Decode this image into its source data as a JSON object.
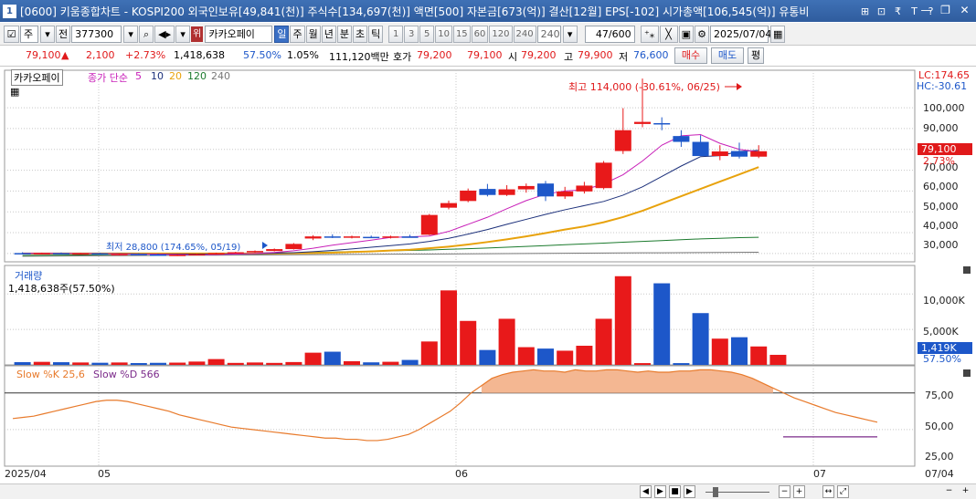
{
  "title_bar": {
    "window_number": "1",
    "text": "[0600] 키움종합차트 - KOSPI200 외국인보유[49,841(천)] 주식수[134,697(천)] 액면[500] 자본금[673(억)] 결산[12월] EPS[-102] 시가총액[106,545(억)] 유통비",
    "icons": [
      "⊞",
      "⊡",
      "₹",
      "T",
      "?"
    ],
    "window_buttons": [
      "—",
      "❐",
      "✕"
    ]
  },
  "toolbar": {
    "stock_code": "377300",
    "type_select": "주",
    "prev_label": "전",
    "stock_name": "카카오페이",
    "name_badge": "위",
    "periods": [
      "일",
      "주",
      "월",
      "년",
      "분",
      "초",
      "틱"
    ],
    "active_period": "일",
    "intervals": [
      "1",
      "3",
      "5",
      "10",
      "15",
      "60",
      "120",
      "240"
    ],
    "interval_select": "240",
    "count": "47",
    "count_total": "/600",
    "date": "2025/07/04"
  },
  "info_row": {
    "price": "79,100",
    "change": "2,100",
    "change_pct": "+2.73%",
    "volume": "1,418,638",
    "vol_ratio": "57.50%",
    "turnover": "1.05%",
    "amount": "111,120백만",
    "bid_label": "호가",
    "bid": "79,200",
    "ask": "79,100",
    "open_label": "시",
    "open": "79,200",
    "high_label": "고",
    "high": "79,900",
    "low_label": "저",
    "low": "76,600",
    "buy_label": "매수",
    "sell_label": "매도",
    "eval_label": "평"
  },
  "price_panel": {
    "stock_tag": "카카오페이",
    "ma_label": "종가 단순",
    "ma_periods": [
      "5",
      "10",
      "20",
      "120",
      "240"
    ],
    "ma_colors": [
      "#c81fb8",
      "#1b2f7a",
      "#e8a20c",
      "#1b7a2d",
      "#777777"
    ],
    "lc_label": "LC:174.65",
    "hc_label": "HC:-30.61",
    "high_annotation": "최고 114,000 (-30.61%, 06/25)",
    "low_annotation": "최저 28,800 (174.65%, 05/19)",
    "current_price_tag": "79,100",
    "current_pct_tag": "2.73%",
    "y_ticks": [
      "100,000",
      "90,000",
      "80,000",
      "70,000",
      "60,000",
      "50,000",
      "40,000",
      "30,000"
    ]
  },
  "volume_panel": {
    "title": "거래량",
    "value": "1,418,638주(57.50%)",
    "y_ticks": [
      "10,000K",
      "5,000K"
    ],
    "current_tag": "1,419K",
    "current_pct": "57.50%"
  },
  "stoch_panel": {
    "k_label": "Slow %K 25,6",
    "d_label": "Slow %D 566",
    "y_ticks": [
      "75,00",
      "50,00",
      "25,00"
    ]
  },
  "x_axis": {
    "labels": [
      "2025/04",
      "05",
      "06",
      "07"
    ],
    "right_label": "07/04"
  },
  "bottom_bar": {
    "buttons": [
      "◀",
      "▶",
      "■",
      "▶",
      "−",
      "+",
      "↔",
      "⤢",
      "−",
      "+"
    ]
  },
  "chart_data": {
    "type": "candlestick",
    "candles": [
      [
        30200,
        30600,
        29800,
        30000
      ],
      [
        30000,
        30400,
        29700,
        30200
      ],
      [
        30200,
        30500,
        29800,
        29900
      ],
      [
        29900,
        30300,
        29600,
        30100
      ],
      [
        30100,
        30300,
        29400,
        29600
      ],
      [
        29600,
        30000,
        29200,
        29800
      ],
      [
        29800,
        30100,
        29300,
        29500
      ],
      [
        29500,
        29900,
        29000,
        29200
      ],
      [
        29200,
        29600,
        28800,
        29400
      ],
      [
        29400,
        29900,
        29100,
        29700
      ],
      [
        29700,
        30400,
        29500,
        30200
      ],
      [
        30200,
        30800,
        30000,
        30600
      ],
      [
        30600,
        31500,
        30400,
        31200
      ],
      [
        31200,
        32400,
        31000,
        32100
      ],
      [
        32100,
        35000,
        31900,
        34600
      ],
      [
        37200,
        38800,
        36400,
        38200
      ],
      [
        38200,
        39200,
        37400,
        37800
      ],
      [
        37800,
        38600,
        37200,
        38200
      ],
      [
        38000,
        38600,
        37400,
        37600
      ],
      [
        37600,
        38600,
        37200,
        38200
      ],
      [
        38200,
        39000,
        37600,
        37500
      ],
      [
        39000,
        49000,
        38800,
        48500
      ],
      [
        52000,
        55400,
        51200,
        54200
      ],
      [
        55200,
        61200,
        54600,
        60200
      ],
      [
        61000,
        63400,
        57400,
        58100
      ],
      [
        58100,
        62800,
        57600,
        60800
      ],
      [
        60800,
        63600,
        59200,
        62400
      ],
      [
        63600,
        64800,
        55200,
        57400
      ],
      [
        57400,
        62000,
        56200,
        59800
      ],
      [
        59800,
        64400,
        58800,
        62600
      ],
      [
        61400,
        74400,
        60800,
        73600
      ],
      [
        79200,
        99800,
        77800,
        89200
      ],
      [
        92200,
        114000,
        90600,
        93200
      ],
      [
        92600,
        95400,
        89200,
        92200
      ],
      [
        86400,
        89200,
        81200,
        83600
      ],
      [
        83600,
        86800,
        77000,
        76800
      ],
      [
        76800,
        82000,
        74800,
        79000
      ],
      [
        79200,
        83200,
        75600,
        76500
      ],
      [
        76500,
        82000,
        75800,
        79100
      ]
    ],
    "volume_k": [
      390,
      430,
      380,
      340,
      300,
      340,
      260,
      290,
      320,
      470,
      820,
      280,
      340,
      280,
      400,
      1720,
      1860,
      520,
      360,
      440,
      700,
      3300,
      10500,
      6200,
      2100,
      6500,
      2500,
      2300,
      2000,
      2700,
      6500,
      12500,
      250,
      11500,
      250,
      7300,
      3700,
      3900,
      2600,
      1419
    ],
    "ma5": [
      30100,
      30100,
      30050,
      30000,
      29950,
      29800,
      29700,
      29600,
      29500,
      29400,
      29500,
      29700,
      30000,
      30500,
      31300,
      32500,
      34000,
      35200,
      36400,
      37700,
      38000,
      38400,
      40600,
      44000,
      47400,
      51500,
      55400,
      58500,
      60000,
      60600,
      63400,
      67800,
      74400,
      82000,
      86500,
      87100,
      82900,
      80000,
      78800
    ],
    "ma10": [
      30000,
      30000,
      30000,
      30000,
      30000,
      29900,
      29800,
      29700,
      29700,
      29700,
      29800,
      29800,
      29900,
      30100,
      30400,
      30900,
      31500,
      32200,
      33000,
      33800,
      34600,
      35800,
      37300,
      39300,
      41500,
      44000,
      46400,
      48800,
      51000,
      53000,
      55000,
      58000,
      62000,
      67000,
      72000,
      76500,
      77000,
      79000,
      79500
    ],
    "ma20": [
      30000,
      30000,
      30000,
      30000,
      30000,
      30000,
      30000,
      30000,
      30000,
      30000,
      30000,
      30000,
      30000,
      30000,
      30100,
      30200,
      30400,
      30700,
      31000,
      31400,
      31800,
      32500,
      33300,
      34300,
      35500,
      36800,
      38200,
      39800,
      41500,
      43000,
      45000,
      47500,
      50500,
      54000,
      57500,
      61000,
      64500,
      68000,
      71500
    ],
    "ma120": [
      29000,
      29100,
      29200,
      29300,
      29400,
      29500,
      29600,
      29700,
      29800,
      29900,
      30000,
      30100,
      30200,
      30300,
      30400,
      30500,
      30700,
      30900,
      31100,
      31300,
      31500,
      31700,
      32000,
      32300,
      32600,
      33000,
      33400,
      33800,
      34200,
      34600,
      35000,
      35400,
      35800,
      36200,
      36600,
      37000,
      37300,
      37600,
      37800
    ],
    "ma240": [
      28700,
      28750,
      28800,
      28850,
      28900,
      28950,
      29000,
      29050,
      29100,
      29150,
      29200,
      29250,
      29300,
      29350,
      29400,
      29450,
      29500,
      29550,
      29600,
      29650,
      29700,
      29750,
      29800,
      29850,
      29900,
      29950,
      30000,
      30050,
      30100,
      30150,
      30200,
      30250,
      30300,
      30350,
      30400,
      30450,
      30500,
      30550,
      30600
    ],
    "stoch_k": [
      59,
      60,
      61,
      63,
      65,
      67,
      69,
      71,
      73,
      74,
      74,
      73,
      71,
      69,
      67,
      65,
      62,
      60,
      58,
      56,
      54,
      52,
      51,
      50,
      49,
      48,
      47,
      46,
      45,
      44,
      43,
      43,
      42,
      42,
      41,
      41,
      42,
      44,
      46,
      50,
      55,
      60,
      65,
      72,
      80,
      86,
      92,
      95,
      97,
      98,
      99,
      98,
      98,
      97,
      99,
      98,
      98,
      99,
      99,
      98,
      97,
      98,
      97,
      97,
      98,
      98,
      99,
      99,
      98,
      97,
      95,
      92,
      88,
      84,
      80,
      76,
      73,
      70,
      67,
      64,
      62,
      60,
      58,
      56
    ],
    "stoch_d_segment": [
      44,
      44
    ],
    "y_range_price": [
      26000,
      118000
    ],
    "y_range_volume_k": [
      0,
      13500
    ],
    "y_range_stoch": [
      20,
      100
    ]
  }
}
